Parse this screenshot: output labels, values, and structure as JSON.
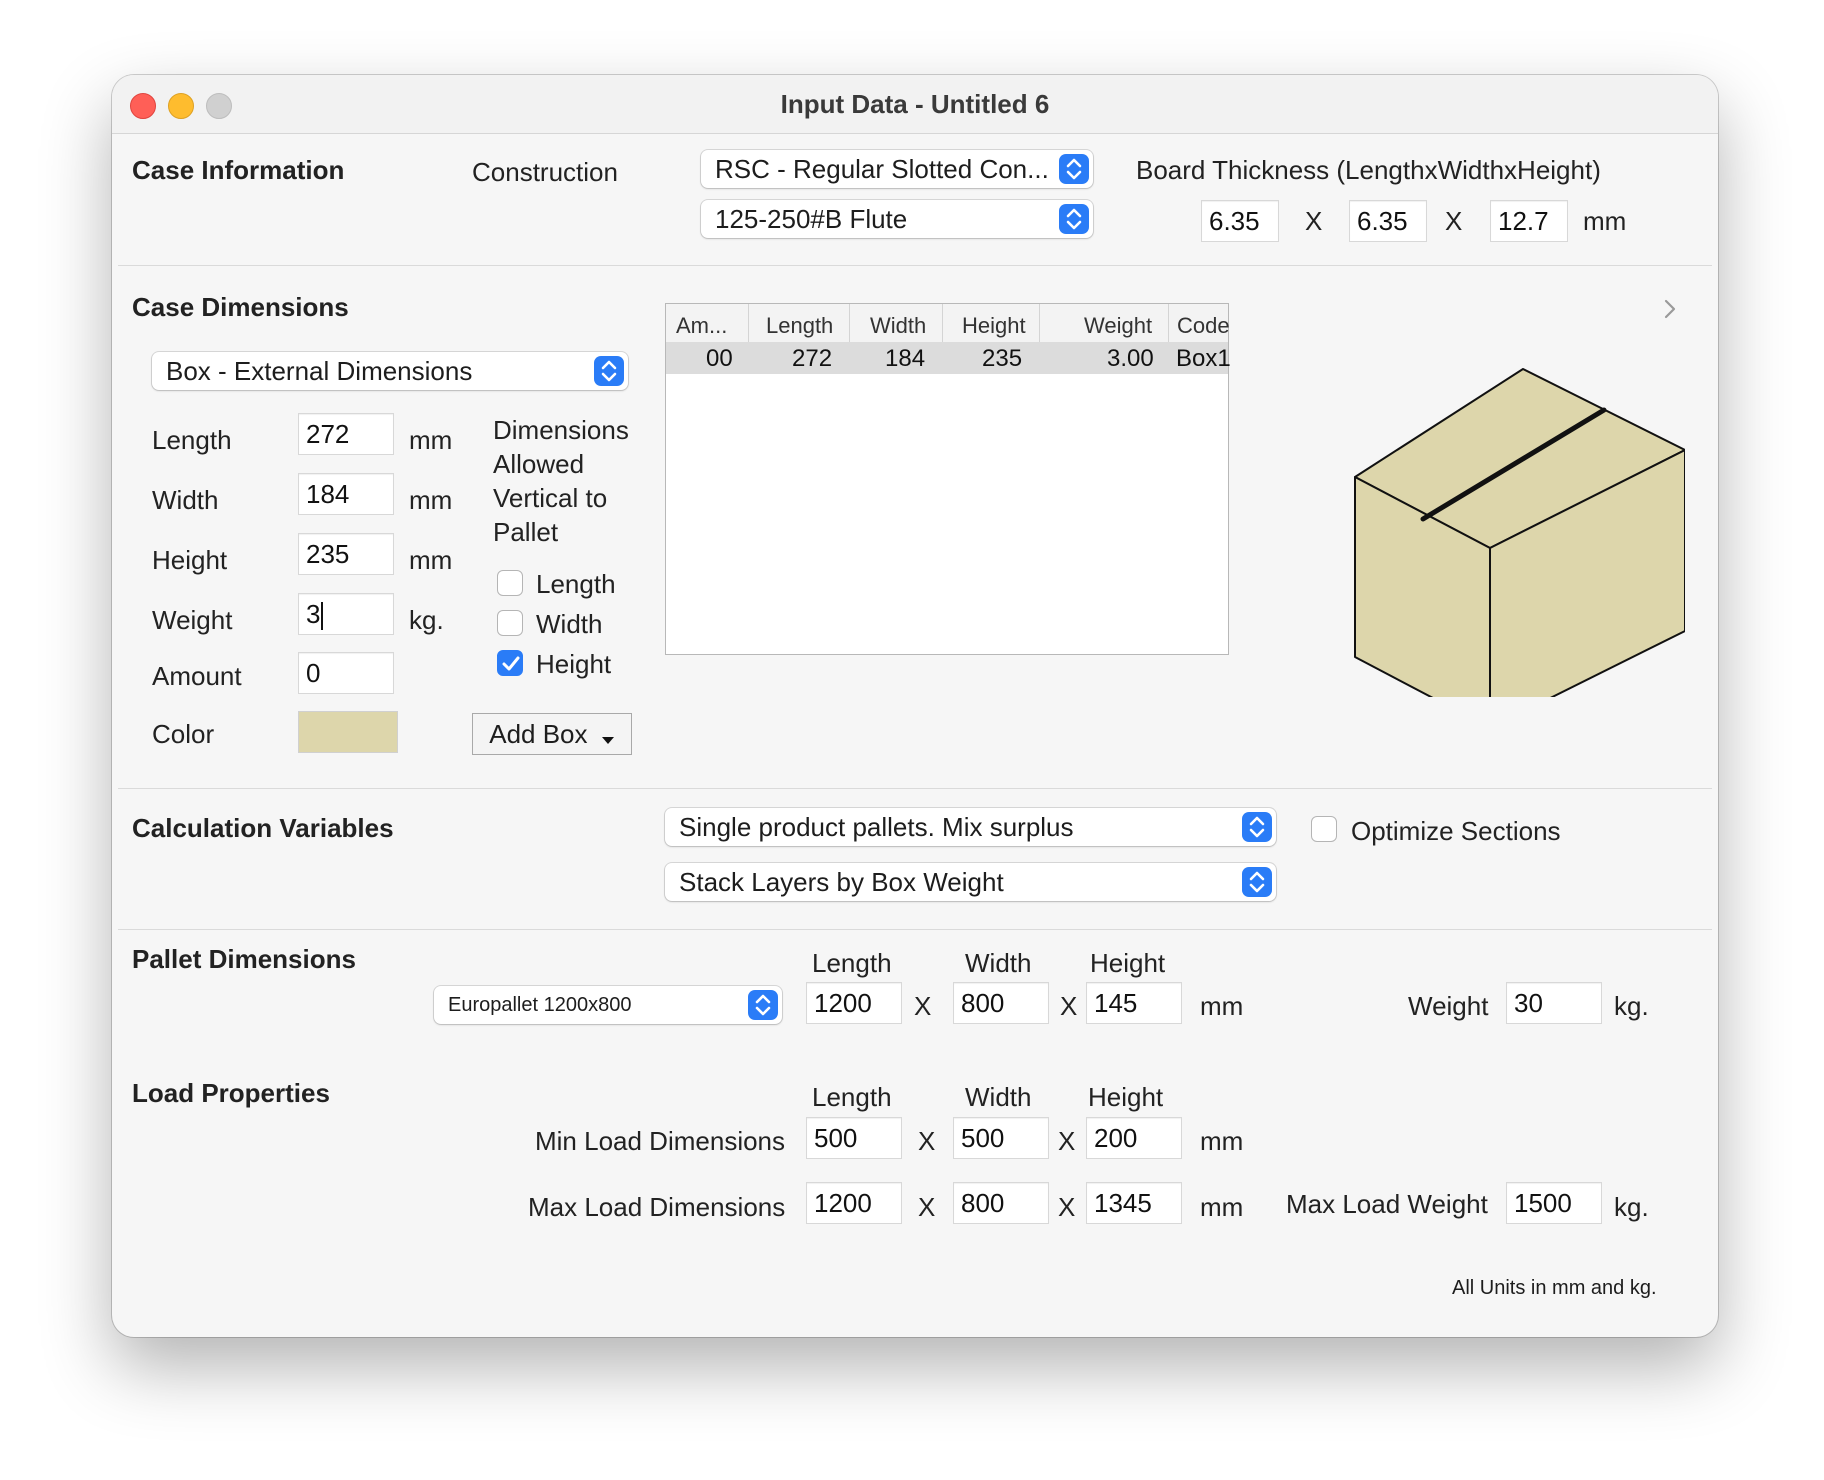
{
  "window": {
    "title": "Input Data - Untitled 6"
  },
  "case_info": {
    "title": "Case Information",
    "construction_label": "Construction",
    "construction_value": "RSC - Regular Slotted Con...",
    "flute_value": "125-250#B Flute",
    "board_label": "Board Thickness (LengthxWidthxHeight)",
    "board_length": "6.35",
    "board_width": "6.35",
    "board_height": "12.7",
    "x1": "X",
    "x2": "X",
    "unit": "mm"
  },
  "case_dims": {
    "title": "Case Dimensions",
    "mode_value": "Box - External Dimensions",
    "length_label": "Length",
    "length_value": "272",
    "length_unit": "mm",
    "width_label": "Width",
    "width_value": "184",
    "width_unit": "mm",
    "height_label": "Height",
    "height_value": "235",
    "height_unit": "mm",
    "weight_label": "Weight",
    "weight_value": "3",
    "weight_unit": "kg.",
    "amount_label": "Amount",
    "amount_value": "0",
    "color_label": "Color",
    "color_value": "#ddd6ab",
    "vertical_heading_1": "Dimensions",
    "vertical_heading_2": "Allowed",
    "vertical_heading_3": "Vertical to",
    "vertical_heading_4": "Pallet",
    "cb_length_label": "Length",
    "cb_width_label": "Width",
    "cb_height_label": "Height",
    "cb_length": false,
    "cb_width": false,
    "cb_height": true,
    "add_box_label": "Add Box",
    "table": {
      "headers": {
        "amount": "Am...",
        "length": "Length",
        "width": "Width",
        "height": "Height",
        "weight": "Weight",
        "code": "Code"
      },
      "rows": [
        {
          "amount": "00",
          "length": "272",
          "width": "184",
          "height": "235",
          "weight": "3.00",
          "code": "Box1"
        }
      ]
    }
  },
  "calc_vars": {
    "title": "Calculation Variables",
    "mode_value": "Single product pallets. Mix surplus",
    "stack_value": "Stack Layers by Box Weight",
    "optimize_label": "Optimize Sections",
    "optimize_checked": false
  },
  "pallet": {
    "title": "Pallet Dimensions",
    "type_value": "Europallet 1200x800",
    "length_header": "Length",
    "width_header": "Width",
    "height_header": "Height",
    "length_value": "1200",
    "width_value": "800",
    "height_value": "145",
    "x1": "X",
    "x2": "X",
    "unit": "mm",
    "weight_label": "Weight",
    "weight_value": "30",
    "weight_unit": "kg."
  },
  "load": {
    "title": "Load Properties",
    "length_header": "Length",
    "width_header": "Width",
    "height_header": "Height",
    "min_label": "Min Load Dimensions",
    "min_length": "500",
    "min_width": "500",
    "min_height": "200",
    "max_label": "Max Load Dimensions",
    "max_length": "1200",
    "max_width": "800",
    "max_height": "1345",
    "x1": "X",
    "x2": "X",
    "x3": "X",
    "x4": "X",
    "unit1": "mm",
    "unit2": "mm",
    "max_weight_label": "Max Load Weight",
    "max_weight_value": "1500",
    "max_weight_unit": "kg."
  },
  "footer": {
    "note": "All Units in mm and kg."
  },
  "icons": {
    "stepper": "up-down-chevrons-icon",
    "checkmark": "checkmark-icon",
    "disclosure": "chevron-right-icon",
    "dropdown": "triangle-down-icon",
    "box_preview": "box-3d-icon"
  },
  "colors": {
    "accent": "#2a7cf7",
    "box_fill": "#ddd6ab"
  }
}
